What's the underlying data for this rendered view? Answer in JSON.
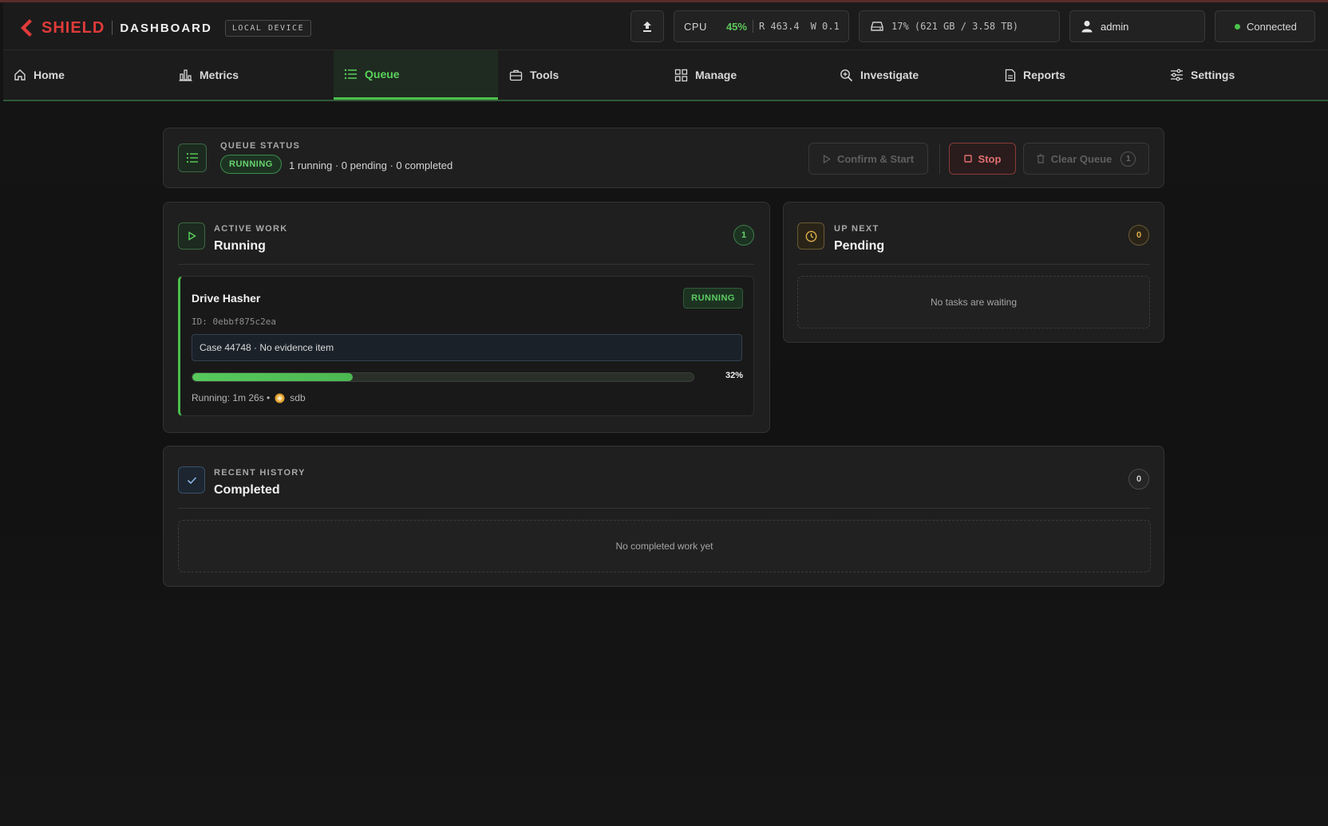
{
  "brand": {
    "name": "SHIELD",
    "subtitle": "DASHBOARD",
    "device_badge": "LOCAL DEVICE"
  },
  "header": {
    "upload_icon": "upload-icon",
    "cpu_label": "CPU",
    "cpu_value": "45%",
    "read": "R 463.4",
    "write": "W 0.1",
    "disk": "17% (621 GB / 3.58 TB)",
    "user": "admin",
    "connection": "Connected"
  },
  "nav": {
    "tabs": [
      {
        "label": "Home",
        "icon": "home-icon"
      },
      {
        "label": "Metrics",
        "icon": "bar-chart-icon"
      },
      {
        "label": "Queue",
        "icon": "list-icon",
        "active": true
      },
      {
        "label": "Tools",
        "icon": "toolbox-icon"
      },
      {
        "label": "Manage",
        "icon": "grid-icon"
      },
      {
        "label": "Investigate",
        "icon": "magnify-plus-icon"
      },
      {
        "label": "Reports",
        "icon": "document-icon"
      },
      {
        "label": "Settings",
        "icon": "sliders-icon"
      }
    ]
  },
  "queue_status": {
    "eyebrow": "QUEUE STATUS",
    "state": "RUNNING",
    "summary": "1 running · 0 pending · 0 completed",
    "confirm_label": "Confirm & Start",
    "stop_label": "Stop",
    "clear_label": "Clear Queue",
    "clear_count": "1"
  },
  "running": {
    "eyebrow": "ACTIVE WORK",
    "title": "Running",
    "count": "1",
    "task": {
      "name": "Drive Hasher",
      "status": "RUNNING",
      "id": "ID: 0ebbf875c2ea",
      "case": "Case 44748 · No evidence item",
      "progress_pct": 32,
      "progress_label": "32%",
      "elapsed": "Running: 1m 26s •",
      "device": "sdb"
    }
  },
  "pending": {
    "eyebrow": "UP NEXT",
    "title": "Pending",
    "count": "0",
    "empty": "No tasks are waiting"
  },
  "history": {
    "eyebrow": "RECENT HISTORY",
    "title": "Completed",
    "count": "0",
    "empty": "No completed work yet"
  },
  "colors": {
    "accent": "#4cbf4c",
    "brand": "#e03a3a",
    "danger": "#e07070",
    "warning": "#e0b04a"
  }
}
